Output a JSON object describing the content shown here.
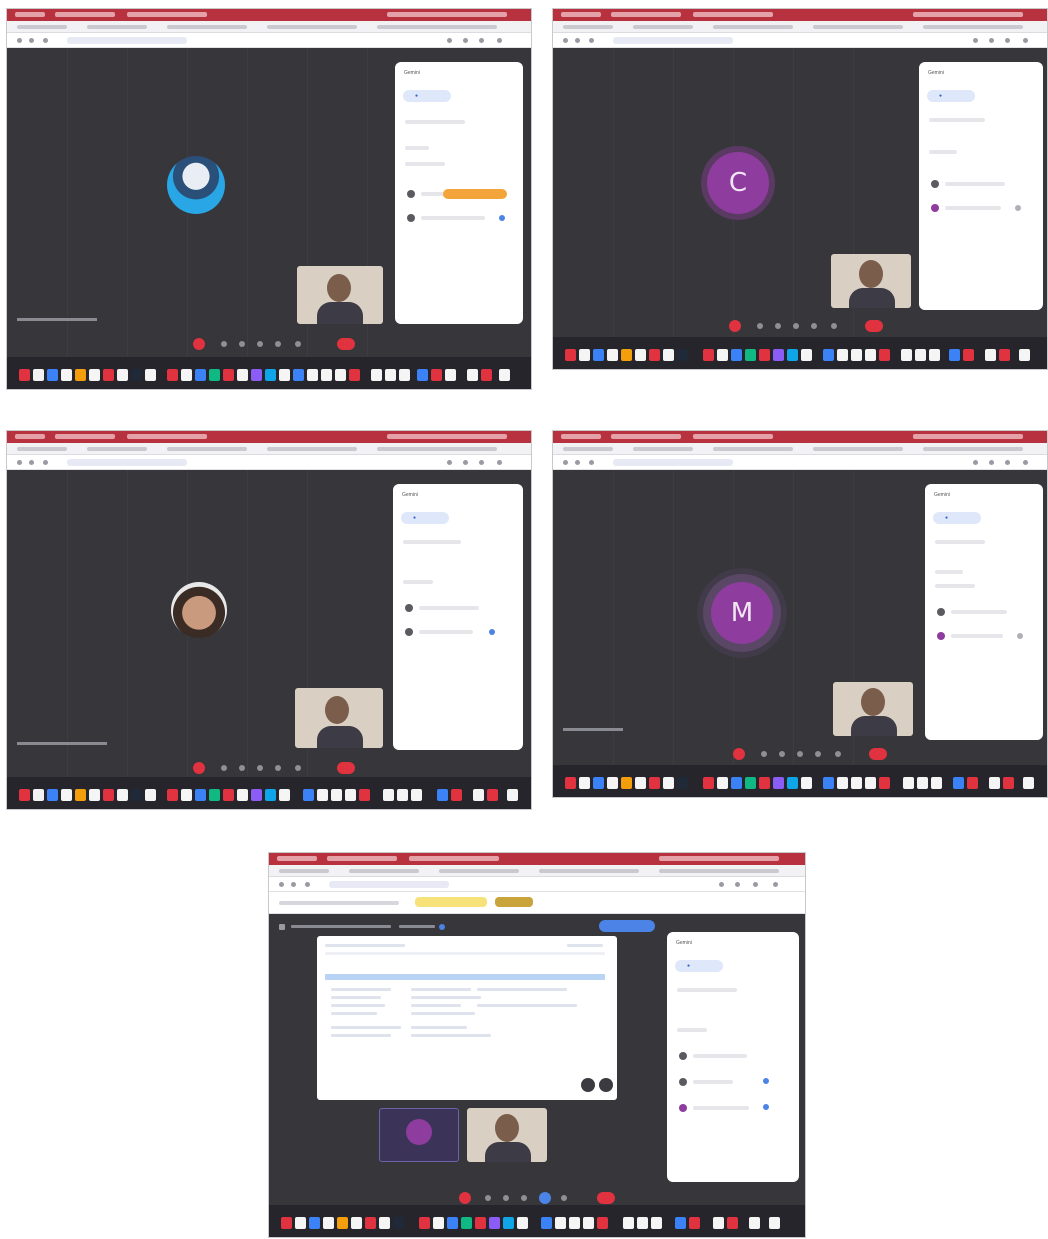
{
  "screenshots": [
    {
      "id": "a",
      "avatar_letter": "",
      "panel_label": "Gemini"
    },
    {
      "id": "b",
      "avatar_letter": "C",
      "panel_label": "Gemini"
    },
    {
      "id": "c",
      "avatar_letter": "",
      "panel_label": "Gemini"
    },
    {
      "id": "d",
      "avatar_letter": "M",
      "panel_label": "Gemini"
    },
    {
      "id": "e",
      "avatar_letter": "",
      "panel_label": "Gemini"
    }
  ],
  "colors": {
    "menubar": "#b8313f",
    "stage": "#36363b",
    "end_call": "#e0323f",
    "avatar_purple": "#8e3c9e",
    "chip_blue": "#2f5fc9"
  },
  "icons": [
    "participant-icon",
    "microphone-icon",
    "camera-icon",
    "present-icon",
    "end-call-icon",
    "dock-app-icon"
  ]
}
